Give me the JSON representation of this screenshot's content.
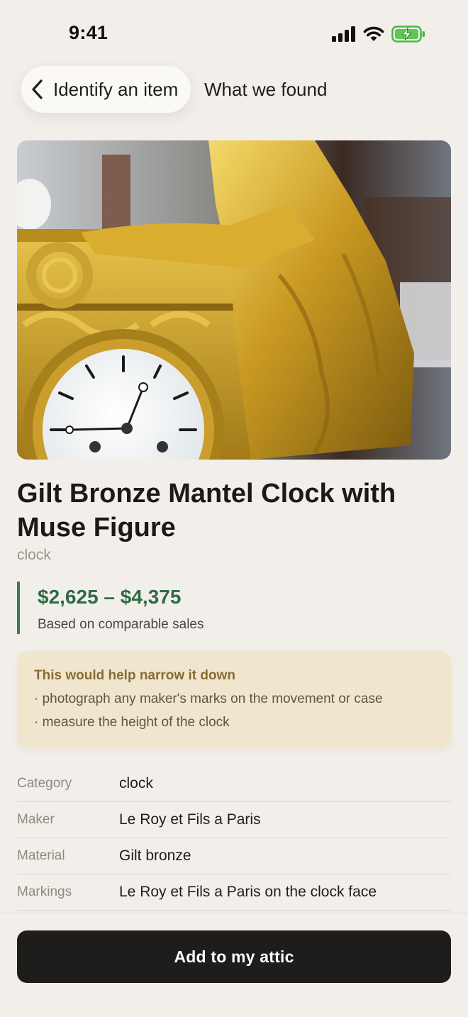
{
  "status_bar": {
    "time": "9:41",
    "icons": [
      "cellular-signal-icon",
      "wifi-icon",
      "battery-charging-icon"
    ]
  },
  "header": {
    "back_label": "Identify an item",
    "title": "What we found"
  },
  "hero": {
    "icon": "gilt-bronze-clock-photo"
  },
  "item": {
    "title": "Gilt Bronze Mantel Clock with Muse Figure",
    "subtitle": "clock"
  },
  "price": {
    "range": "$2,625 – $4,375",
    "note": "Based on comparable sales",
    "accent_color": "#2f6b43"
  },
  "hint": {
    "title": "This would help narrow it down",
    "items": [
      "· photograph any maker's marks on the movement or case",
      "· measure the height of the clock"
    ]
  },
  "details": [
    {
      "key": "Category",
      "value": "clock"
    },
    {
      "key": "Maker",
      "value": "Le Roy et Fils a Paris"
    },
    {
      "key": "Material",
      "value": "Gilt bronze"
    },
    {
      "key": "Markings",
      "value": "Le Roy et Fils a Paris on the clock face"
    }
  ],
  "actions": {
    "add_label": "Add to my attic"
  }
}
